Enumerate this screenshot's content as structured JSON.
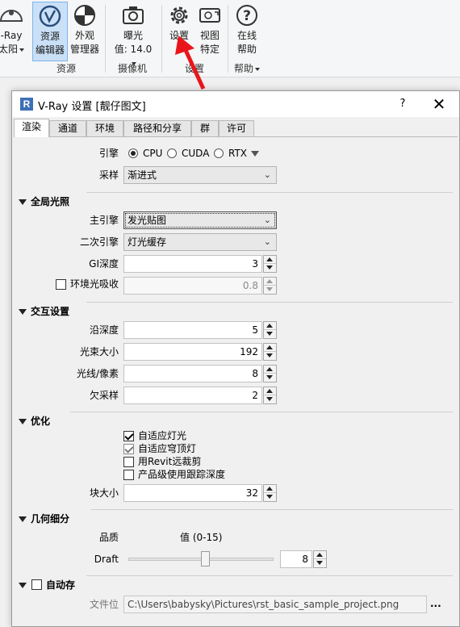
{
  "ribbon": {
    "sun": {
      "line1": "-Ray",
      "line2": "太阳"
    },
    "asset_editor": {
      "line1": "资源",
      "line2": "编辑器"
    },
    "appearance_manager": {
      "line1": "外观",
      "line2": "管理器"
    },
    "exposure": {
      "line1": "曝光",
      "line2": "值: 14.0"
    },
    "settings": {
      "line1": "设置"
    },
    "view_specific": {
      "line1": "视图",
      "line2": "特定"
    },
    "online_help": {
      "line1": "在线",
      "line2": "帮助"
    },
    "groups": {
      "resources": "资源",
      "camera": "摄像机",
      "settings": "设置",
      "help": "帮助"
    }
  },
  "dialog": {
    "title": "V-Ray 设置 [靓仔图文]",
    "title_icon": "R",
    "help_label": "?",
    "close_label": "✕",
    "tabs": [
      "渲染",
      "通道",
      "环境",
      "路径和分享",
      "群",
      "许可"
    ],
    "active_tab": 0
  },
  "render": {
    "engine_label": "引擎",
    "engine_options": [
      "CPU",
      "CUDA",
      "RTX"
    ],
    "engine_selected": "CPU",
    "sampling_label": "采样",
    "sampling_value": "渐进式"
  },
  "gi": {
    "title": "全局光照",
    "primary_label": "主引擎",
    "primary_value": "发光贴图",
    "secondary_label": "二次引擎",
    "secondary_value": "灯光缓存",
    "depth_label": "GI深度",
    "depth_value": "3",
    "ao_label": "环境光吸收",
    "ao_checked": false,
    "ao_value": "0.8"
  },
  "interactive": {
    "title": "交互设置",
    "trace_depth_label": "沿深度",
    "trace_depth_value": "5",
    "bundle_size_label": "光束大小",
    "bundle_size_value": "192",
    "rays_label": "光线/像素",
    "rays_value": "8",
    "undersample_label": "欠采样",
    "undersample_value": "2"
  },
  "optimize": {
    "title": "优化",
    "adaptive_lights": "自适应灯光",
    "adaptive_dome": "自适应穹顶灯",
    "revit_clip": "用Revit远裁剪",
    "product_depth": "产品级使用跟踪深度",
    "bucket_label": "块大小",
    "bucket_value": "32"
  },
  "subdiv": {
    "title": "几何细分",
    "quality_label": "品质",
    "range_label": "值 (0-15)",
    "draft_label": "Draft",
    "slider_fraction": 0.53,
    "value": "8"
  },
  "autosave": {
    "title": "自动存",
    "checked": false,
    "file_label": "文件位",
    "file_path": "C:\\Users\\babysky\\Pictures\\rst_basic_sample_project.png",
    "browse_label": "..."
  },
  "colors": {
    "accent": "#3d6fb6",
    "arrow": "#e8161b",
    "active_ribbon": "#c9e0f7"
  }
}
